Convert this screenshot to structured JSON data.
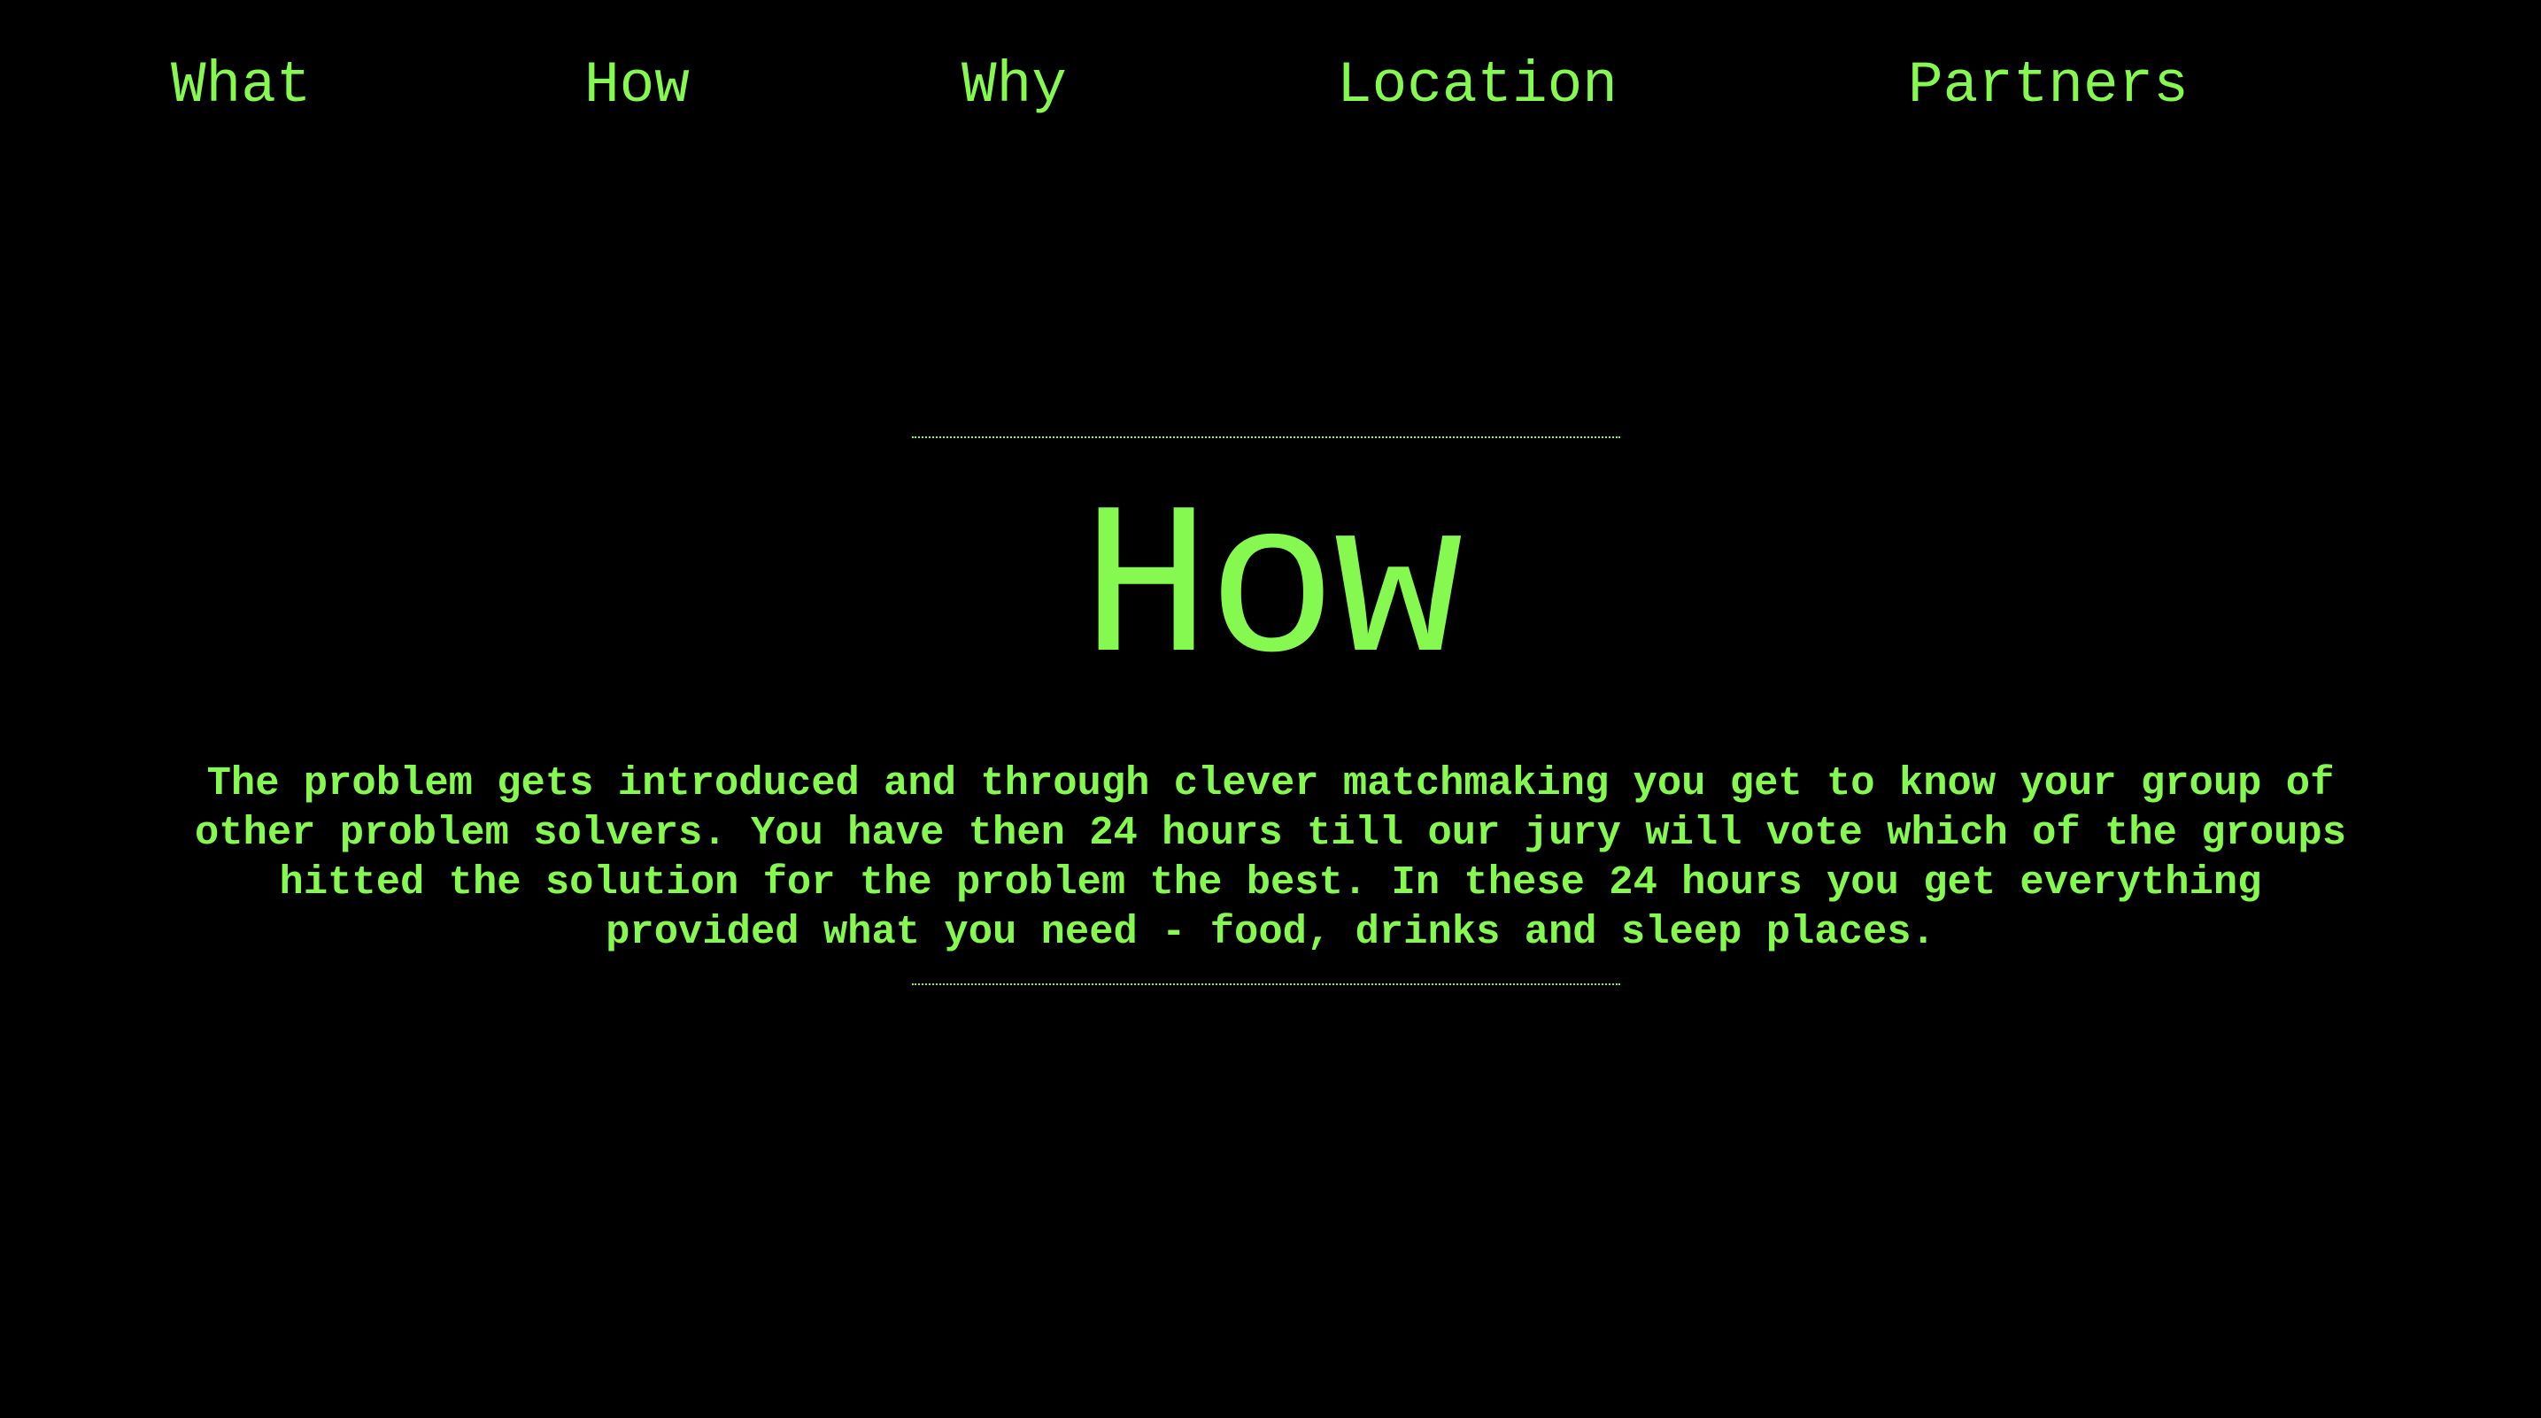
{
  "nav": {
    "items": [
      {
        "label": "What"
      },
      {
        "label": "How"
      },
      {
        "label": "Why"
      },
      {
        "label": "Location"
      },
      {
        "label": "Partners"
      }
    ]
  },
  "section": {
    "title": "How",
    "text": "The problem gets introduced and through clever matchmaking you get to know your group of other problem solvers. You have then 24 hours till our jury will vote which of the groups hitted the solution for the problem the best. In these 24 hours you get everything provided what you need - food, drinks and sleep places."
  },
  "theme": {
    "background": "#000000",
    "accent": "#86f950"
  }
}
